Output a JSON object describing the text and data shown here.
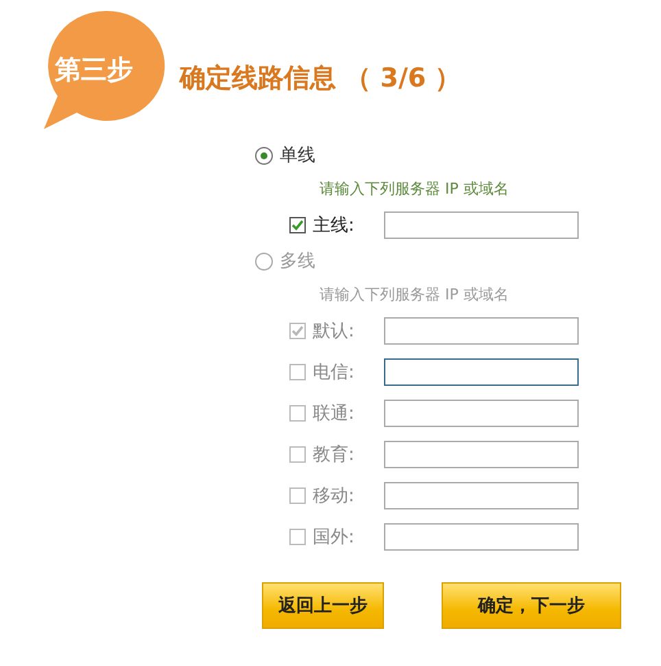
{
  "step_badge": "第三步",
  "title": "确定线路信息 （ 3/6 ）",
  "modes": [
    {
      "label": "单线",
      "selected": true,
      "disabled": false,
      "hint": "请输入下列服务器 IP 或域名",
      "lines": [
        {
          "label": "主线:",
          "checked": true,
          "disabled": false,
          "focused": false
        }
      ]
    },
    {
      "label": "多线",
      "selected": false,
      "disabled": true,
      "hint": "请输入下列服务器 IP 或域名",
      "lines": [
        {
          "label": "默认:",
          "checked": true,
          "disabled": true,
          "focused": false
        },
        {
          "label": "电信:",
          "checked": false,
          "disabled": true,
          "focused": true
        },
        {
          "label": "联通:",
          "checked": false,
          "disabled": true,
          "focused": false
        },
        {
          "label": "教育:",
          "checked": false,
          "disabled": true,
          "focused": false
        },
        {
          "label": "移动:",
          "checked": false,
          "disabled": true,
          "focused": false
        },
        {
          "label": "国外:",
          "checked": false,
          "disabled": true,
          "focused": false
        }
      ]
    }
  ],
  "buttons": [
    "返回上一步",
    "确定，下一步"
  ]
}
